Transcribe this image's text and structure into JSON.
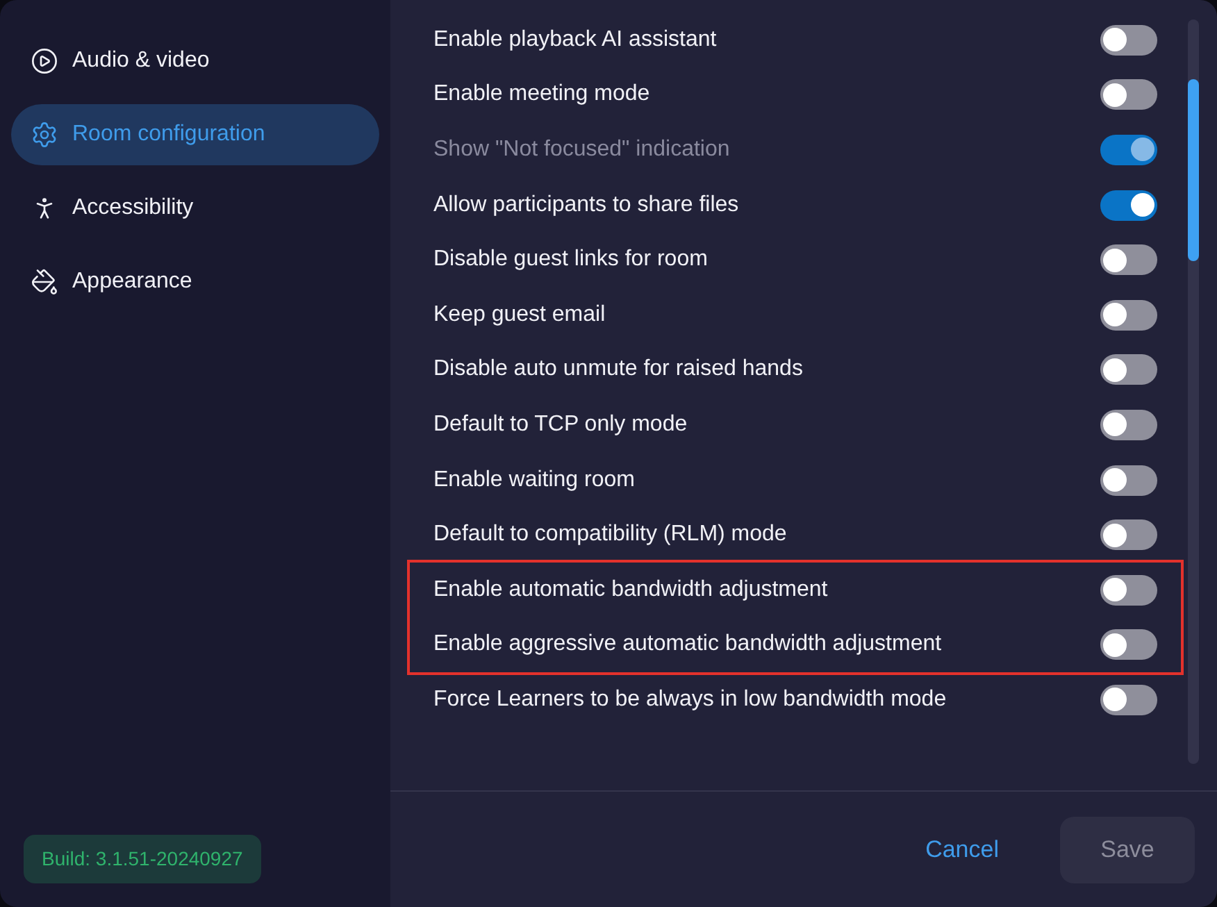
{
  "sidebar": {
    "items": [
      {
        "label": "Audio & video",
        "selected": false
      },
      {
        "label": "Room configuration",
        "selected": true
      },
      {
        "label": "Accessibility",
        "selected": false
      },
      {
        "label": "Appearance",
        "selected": false
      }
    ],
    "build_badge": "Build: 3.1.51-20240927"
  },
  "settings": [
    {
      "label": "Enable playback AI assistant",
      "on": false,
      "disabled": false,
      "highlighted": false
    },
    {
      "label": "Enable meeting mode",
      "on": false,
      "disabled": false,
      "highlighted": false
    },
    {
      "label": "Show \"Not focused\" indication",
      "on": true,
      "disabled": true,
      "highlighted": false
    },
    {
      "label": "Allow participants to share files",
      "on": true,
      "disabled": false,
      "highlighted": false
    },
    {
      "label": "Disable guest links for room",
      "on": false,
      "disabled": false,
      "highlighted": false
    },
    {
      "label": "Keep guest email",
      "on": false,
      "disabled": false,
      "highlighted": false
    },
    {
      "label": "Disable auto unmute for raised hands",
      "on": false,
      "disabled": false,
      "highlighted": false
    },
    {
      "label": "Default to TCP only mode",
      "on": false,
      "disabled": false,
      "highlighted": false
    },
    {
      "label": "Enable waiting room",
      "on": false,
      "disabled": false,
      "highlighted": false
    },
    {
      "label": "Default to compatibility (RLM) mode",
      "on": false,
      "disabled": false,
      "highlighted": false
    },
    {
      "label": "Enable automatic bandwidth adjustment",
      "on": false,
      "disabled": false,
      "highlighted": true
    },
    {
      "label": "Enable aggressive automatic bandwidth adjustment",
      "on": false,
      "disabled": false,
      "highlighted": true
    },
    {
      "label": "Force Learners to be always in low bandwidth mode",
      "on": false,
      "disabled": false,
      "highlighted": false
    }
  ],
  "footer": {
    "buttons": [
      {
        "label": "Cancel",
        "kind": "link",
        "disabled": false
      },
      {
        "label": "Save",
        "kind": "primary",
        "disabled": true
      }
    ]
  }
}
